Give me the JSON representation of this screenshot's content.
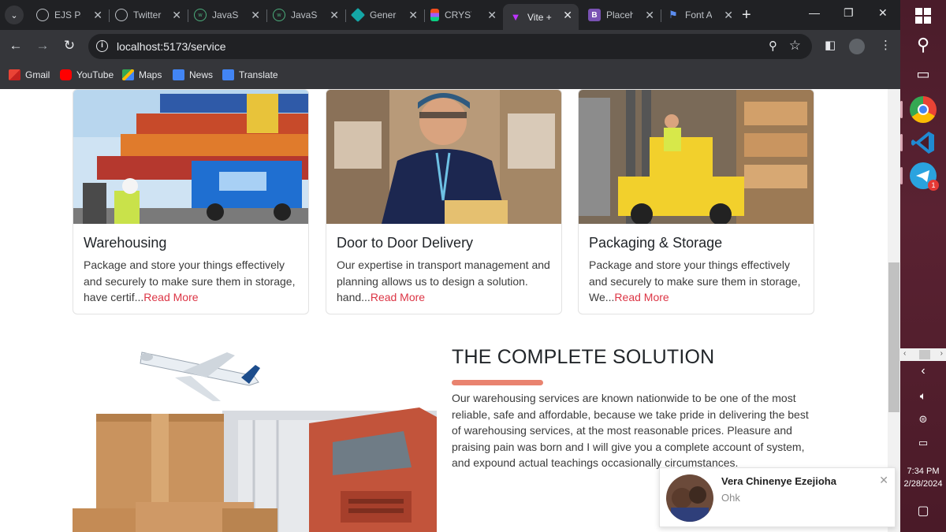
{
  "browser": {
    "tabs": [
      {
        "title": "EJS Par",
        "icon": "globe-icon"
      },
      {
        "title": "Twitter",
        "icon": "globe-icon"
      },
      {
        "title": "JavaScr",
        "icon": "w3-icon"
      },
      {
        "title": "JavaScr",
        "icon": "w3-icon"
      },
      {
        "title": "Genera",
        "icon": "diamond-icon"
      },
      {
        "title": "CRYST",
        "icon": "figma-icon"
      },
      {
        "title": "Vite +",
        "icon": "vite-icon",
        "active": true
      },
      {
        "title": "Placeh",
        "icon": "bootstrap-icon"
      },
      {
        "title": "Font A",
        "icon": "flag-icon"
      }
    ],
    "url": "localhost:5173/service",
    "bookmarks": [
      "Gmail",
      "YouTube",
      "Maps",
      "News",
      "Translate"
    ]
  },
  "services": [
    {
      "title": "Warehousing",
      "desc": "Package and store your things effectively and securely to make sure them in storage, have certif...",
      "link": "Read More"
    },
    {
      "title": "Door to Door Delivery",
      "desc": "Our expertise in transport management and planning allows us to design a solution. hand...",
      "link": "Read More"
    },
    {
      "title": "Packaging & Storage",
      "desc": "Package and store your things effectively and securely to make sure them in storage, We...",
      "link": "Read More"
    }
  ],
  "solution": {
    "title": "THE COMPLETE SOLUTION",
    "text": "Our warehousing services are known nationwide to be one of the most reliable, safe and affordable, because we take pride in delivering the best of warehousing services, at the most reasonable prices. Pleasure and praising pain was born and I will give you a complete account of system, and expound actual teachings occasionally circumstances."
  },
  "notification": {
    "name": "Vera Chinenye Ezejioha",
    "message": "Ohk"
  },
  "taskbar": {
    "time": "7:34 PM",
    "date": "2/28/2024",
    "telegram_badge": "1"
  },
  "colors": {
    "accent": "#dc3545",
    "underline": "#e9836f",
    "chrome_dark": "#202124",
    "chrome": "#35363a"
  }
}
